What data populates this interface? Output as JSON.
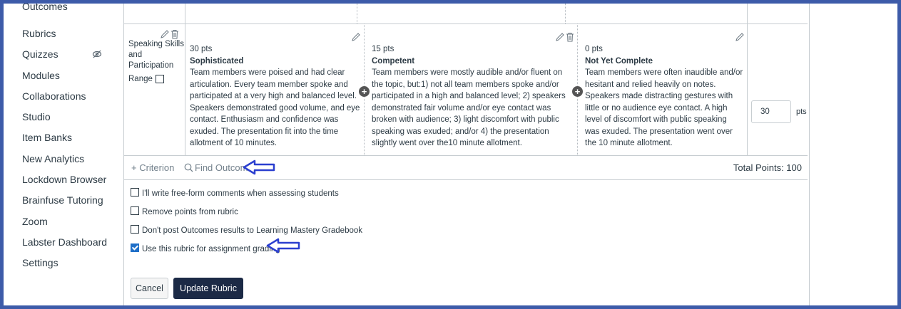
{
  "sidebar": {
    "items": [
      {
        "label": "Outcomes"
      },
      {
        "label": "Rubrics"
      },
      {
        "label": "Quizzes"
      },
      {
        "label": "Modules"
      },
      {
        "label": "Collaborations"
      },
      {
        "label": "Studio"
      },
      {
        "label": "Item Banks"
      },
      {
        "label": "New Analytics"
      },
      {
        "label": "Lockdown Browser"
      },
      {
        "label": "Brainfuse Tutoring"
      },
      {
        "label": "Zoom"
      },
      {
        "label": "Labster Dashboard"
      },
      {
        "label": "Settings"
      }
    ]
  },
  "criterion": {
    "description": "Speaking Skills and Participation",
    "range_label": "Range",
    "points": "30",
    "points_unit": "pts",
    "ratings": [
      {
        "pts": "30 pts",
        "title": "Sophisticated",
        "description": "Team members were poised and had clear articulation. Every team member spoke and participated at a very high and balanced level. Speakers demonstrated good volume, and eye contact. Enthusiasm and confidence was exuded. The presentation fit into the time allotment of 10 minutes."
      },
      {
        "pts": "15 pts",
        "title": "Competent",
        "description": "Team members were mostly audible and/or fluent on the topic, but:1) not all team members spoke and/or participated in a high and balanced level; 2) speakers demonstrated fair volume and/or eye contact was broken with audience; 3) light discomfort with public speaking was exuded; and/or 4) the presentation slightly went over the10 minute allotment."
      },
      {
        "pts": "0 pts",
        "title": "Not Yet Complete",
        "description": "Team members were often inaudible and/or hesitant and relied heavily on notes. Speakers made distracting gestures with little or no audience eye contact. A high level of discomfort with public speaking was exuded. The presentation went over the 10 minute allotment."
      }
    ]
  },
  "footer": {
    "add_criterion": "+ Criterion",
    "find_outcome": "Find Outcome",
    "total_points": "Total Points: 100"
  },
  "options": [
    {
      "label": "I'll write free-form comments when assessing students",
      "checked": false
    },
    {
      "label": "Remove points from rubric",
      "checked": false
    },
    {
      "label": "Don't post Outcomes results to Learning Mastery Gradebook",
      "checked": false
    },
    {
      "label": "Use this rubric for assignment grading",
      "checked": true
    }
  ],
  "buttons": {
    "cancel": "Cancel",
    "update": "Update Rubric"
  },
  "colors": {
    "frame": "#3d5ba9",
    "annotation_arrow": "#2b3fcf",
    "primary_button": "#1c2a46",
    "checkbox_checked": "#1f6fc8"
  }
}
